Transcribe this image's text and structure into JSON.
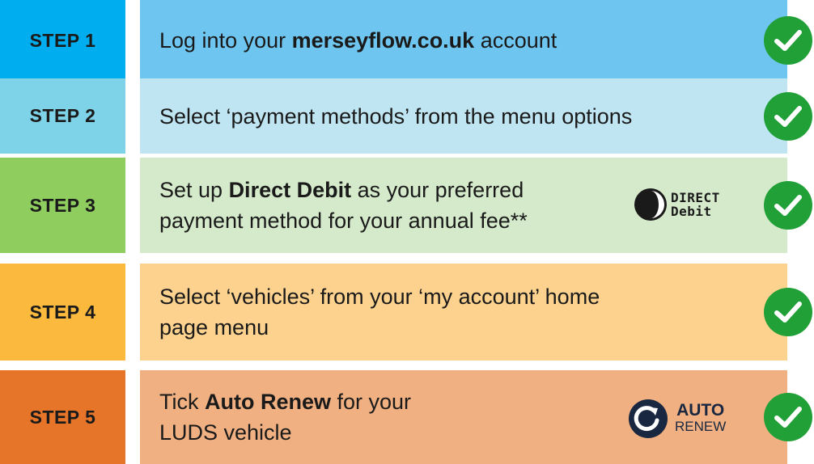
{
  "steps": [
    {
      "label": "STEP 1",
      "text_before": "Log into your ",
      "text_bold": "merseyflow.co.uk",
      "text_after": " account",
      "step_color": "#00aeef",
      "content_color": "#6ec6f0"
    },
    {
      "label": "STEP 2",
      "text": "Select ‘payment methods’ from the menu options",
      "step_color": "#7fd3e8",
      "content_color": "#bfe5f2"
    },
    {
      "label": "STEP 3",
      "line1_before": "Set up ",
      "line1_bold": "Direct Debit",
      "line1_after": " as your preferred",
      "line2": "payment method for your annual fee**",
      "logo_line1": "DIRECT",
      "logo_line2": "Debit",
      "step_color": "#8fcd5f",
      "content_color": "#d5eacb"
    },
    {
      "label": "STEP 4",
      "line1": "Select ‘vehicles’ from your ‘my account’ home",
      "line2": "page menu",
      "step_color": "#fbb93d",
      "content_color": "#fdd28f"
    },
    {
      "label": "STEP 5",
      "line1_before": "Tick ",
      "line1_bold": "Auto Renew",
      "line1_after": " for your",
      "line2": "LUDS vehicle",
      "logo_line1": "AUTO",
      "logo_line2": "RENEW",
      "step_color": "#e6752a",
      "content_color": "#f0b081"
    }
  ],
  "icons": {
    "check": "check-circle-icon",
    "direct_debit": "direct-debit-logo",
    "auto_renew": "auto-renew-logo"
  },
  "colors": {
    "check_green": "#21a038",
    "logo_navy": "#1a2740"
  }
}
